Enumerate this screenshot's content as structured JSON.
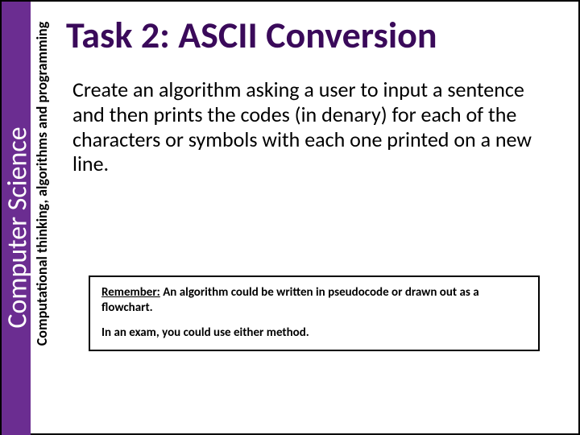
{
  "sidebar": {
    "main": "Computer Science",
    "sub": "Computational thinking, algorithms and programming"
  },
  "title": "Task 2: ASCII Conversion",
  "body": "Create an algorithm asking a user to input a sentence and then prints the codes (in denary) for each of the characters or symbols with each one printed on a new line.",
  "callout": {
    "remember_label": "Remember:",
    "remember_text": "  An algorithm could be written in pseudocode or drawn out as a flowchart.",
    "exam_text": "In an exam, you could use either method."
  },
  "colors": {
    "accent_purple": "#6b2d91",
    "title_purple": "#3a0a5a"
  }
}
